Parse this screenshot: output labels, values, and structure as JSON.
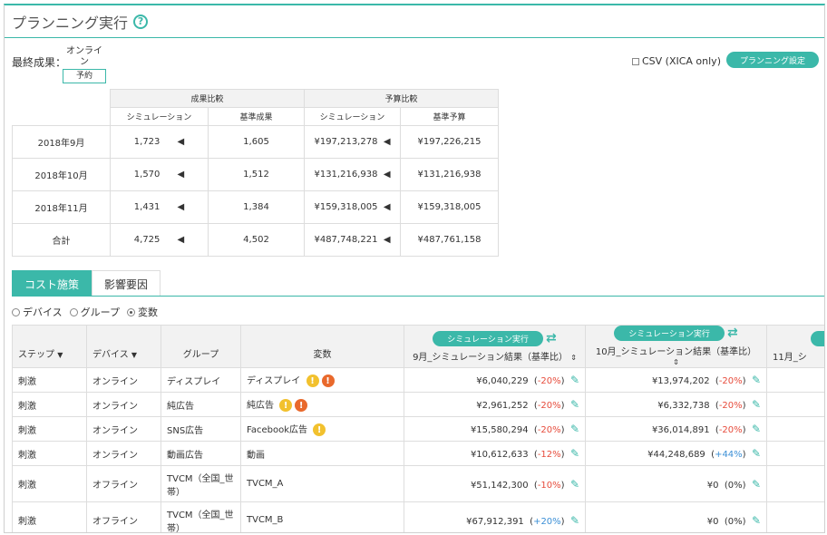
{
  "header": {
    "title": "プランニング実行",
    "help": "?"
  },
  "result": {
    "label": "最終成果：",
    "online": "オンライン",
    "yoyaku": "予約"
  },
  "csv_label": "CSV (XICA only)",
  "planning_button": "プランニング設定",
  "summary": {
    "group1": "成果比較",
    "group2": "予算比較",
    "sub": [
      "シミュレーション",
      "基準成果",
      "シミュレーション",
      "基準予算"
    ],
    "arrow": "◀",
    "rows": [
      {
        "label": "2018年9月",
        "c1": "1,723",
        "c2": "1,605",
        "c3": "¥197,213,278",
        "c4": "¥197,226,215"
      },
      {
        "label": "2018年10月",
        "c1": "1,570",
        "c2": "1,512",
        "c3": "¥131,216,938",
        "c4": "¥131,216,938"
      },
      {
        "label": "2018年11月",
        "c1": "1,431",
        "c2": "1,384",
        "c3": "¥159,318,005",
        "c4": "¥159,318,005"
      },
      {
        "label": "合計",
        "c1": "4,725",
        "c2": "4,502",
        "c3": "¥487,748,221",
        "c4": "¥487,761,158"
      }
    ]
  },
  "tabs": [
    "コスト施策",
    "影響要因"
  ],
  "radios": [
    "デバイス",
    "グループ",
    "変数"
  ],
  "table": {
    "headers": {
      "step": "ステップ",
      "device": "デバイス",
      "group": "グループ",
      "variable": "変数",
      "sim_button": "シミュレーション実行",
      "sept": "9月_シミュレーション結果（基準比）",
      "oct": "10月_シミュレーション結果（基準比）",
      "nov": "11月_シ",
      "nov_btn": "シ",
      "filter": "▼",
      "sort": "⇕",
      "swap": "⇄"
    },
    "rows": [
      {
        "step": "刺激",
        "device": "オンライン",
        "group": "ディスプレイ",
        "variable": "ディスプレイ",
        "warn": [
          "!",
          "!"
        ],
        "sept": "¥6,040,229",
        "sept_pct": "-20%",
        "oct": "¥13,974,202",
        "oct_pct": "-20%"
      },
      {
        "step": "刺激",
        "device": "オンライン",
        "group": "純広告",
        "variable": "純広告",
        "warn": [
          "!",
          "!"
        ],
        "sept": "¥2,961,252",
        "sept_pct": "-20%",
        "oct": "¥6,332,738",
        "oct_pct": "-20%"
      },
      {
        "step": "刺激",
        "device": "オンライン",
        "group": "SNS広告",
        "variable": "Facebook広告",
        "warn": [
          "!"
        ],
        "sept": "¥15,580,294",
        "sept_pct": "-20%",
        "oct": "¥36,014,891",
        "oct_pct": "-20%"
      },
      {
        "step": "刺激",
        "device": "オンライン",
        "group": "動画広告",
        "variable": "動画",
        "warn": [],
        "sept": "¥10,612,633",
        "sept_pct": "-12%",
        "oct": "¥44,248,689",
        "oct_pct": "+44%"
      },
      {
        "step": "刺激",
        "device": "オフライン",
        "group": "TVCM（全国_世帯）",
        "variable": "TVCM_A",
        "warn": [],
        "sept": "¥51,142,300",
        "sept_pct": "-10%",
        "oct": "¥0",
        "oct_pct": "0%"
      },
      {
        "step": "刺激",
        "device": "オフライン",
        "group": "TVCM（全国_世帯）",
        "variable": "TVCM_B",
        "warn": [],
        "sept": "¥67,912,391",
        "sept_pct": "+20%",
        "oct": "¥0",
        "oct_pct": "0%"
      }
    ]
  }
}
